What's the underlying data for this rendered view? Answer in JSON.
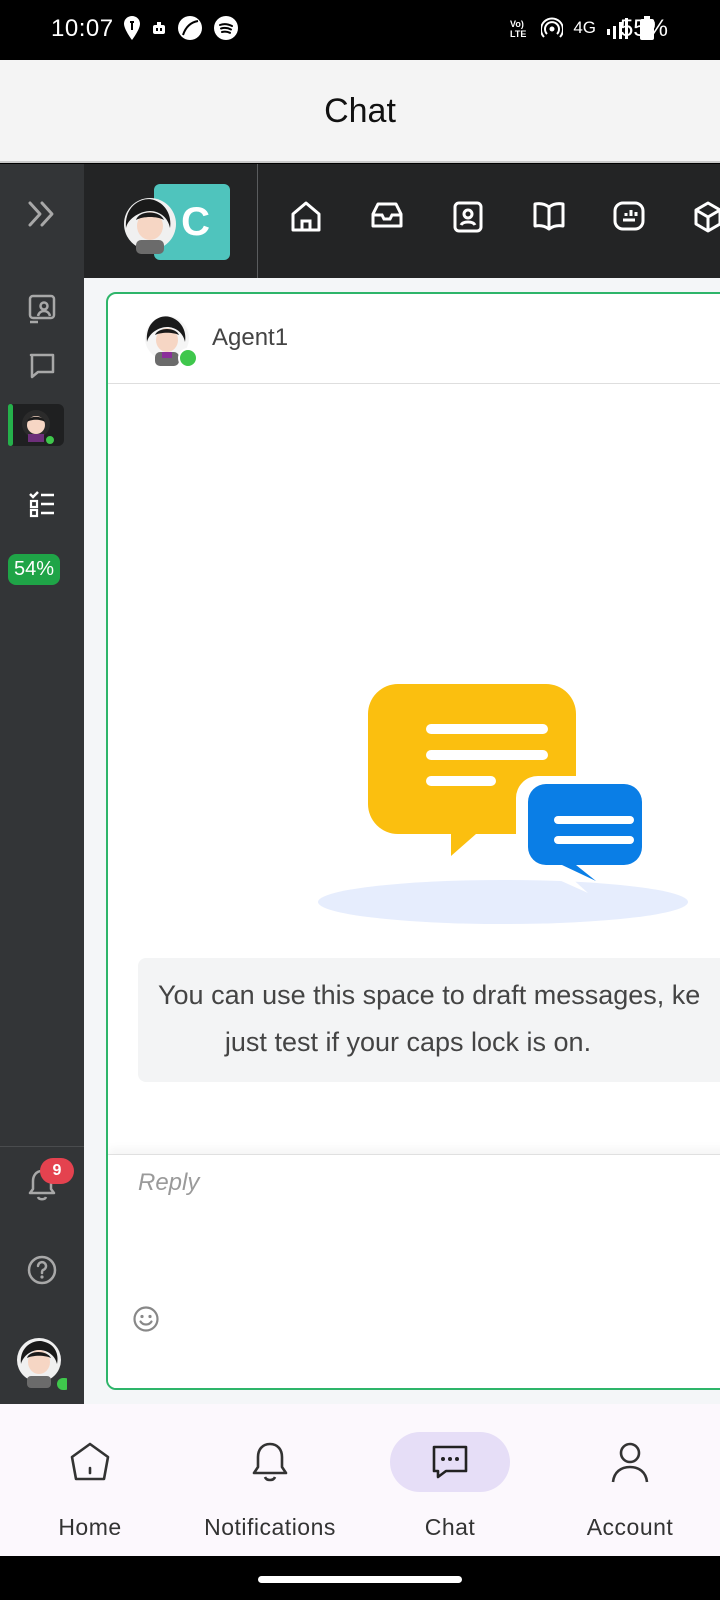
{
  "status_bar": {
    "time": "10:07",
    "network": "4G",
    "battery": "55%",
    "left_icons": [
      "maps-pin-icon",
      "app-notif-icon",
      "leaf-icon",
      "spotify-icon"
    ],
    "right_icons": [
      "volte-icon",
      "hotspot-icon",
      "4g-icon",
      "signal-icon",
      "battery-icon"
    ]
  },
  "app_bar": {
    "title": "Chat"
  },
  "sidebar": {
    "items": [
      {
        "name": "expand-icon"
      },
      {
        "name": "contacts-icon"
      },
      {
        "name": "conversations-icon"
      },
      {
        "name": "active-conversation-avatar"
      },
      {
        "name": "checklist-icon"
      }
    ],
    "progress": "54%",
    "notifications_count": "9"
  },
  "toolbar": {
    "workspace_letter": "C",
    "icons": [
      "home-icon",
      "inbox-icon",
      "contacts-book-icon",
      "knowledge-book-icon",
      "reports-icon",
      "package-icon"
    ]
  },
  "chat": {
    "agent_name": "Agent1",
    "agent_status": "online",
    "hint_line1": "You can use this space to draft messages, ke",
    "hint_line2": "just test if your caps lock is on.",
    "reply_placeholder": "Reply"
  },
  "bottom_nav": {
    "items": [
      {
        "label": "Home",
        "icon": "home-icon"
      },
      {
        "label": "Notifications",
        "icon": "bell-icon"
      },
      {
        "label": "Chat",
        "icon": "chat-icon",
        "active": true
      },
      {
        "label": "Account",
        "icon": "account-icon"
      }
    ]
  },
  "colors": {
    "accent_green": "#2eb56a",
    "sidebar_bg": "#333537",
    "toolbar_bg": "#232425",
    "workspace_tile": "#4fc4bd",
    "badge_red": "#e4424f",
    "chat_yellow": "#fbbf0f",
    "chat_blue": "#0a7ee6",
    "nav_active_bg": "#e6def7"
  }
}
